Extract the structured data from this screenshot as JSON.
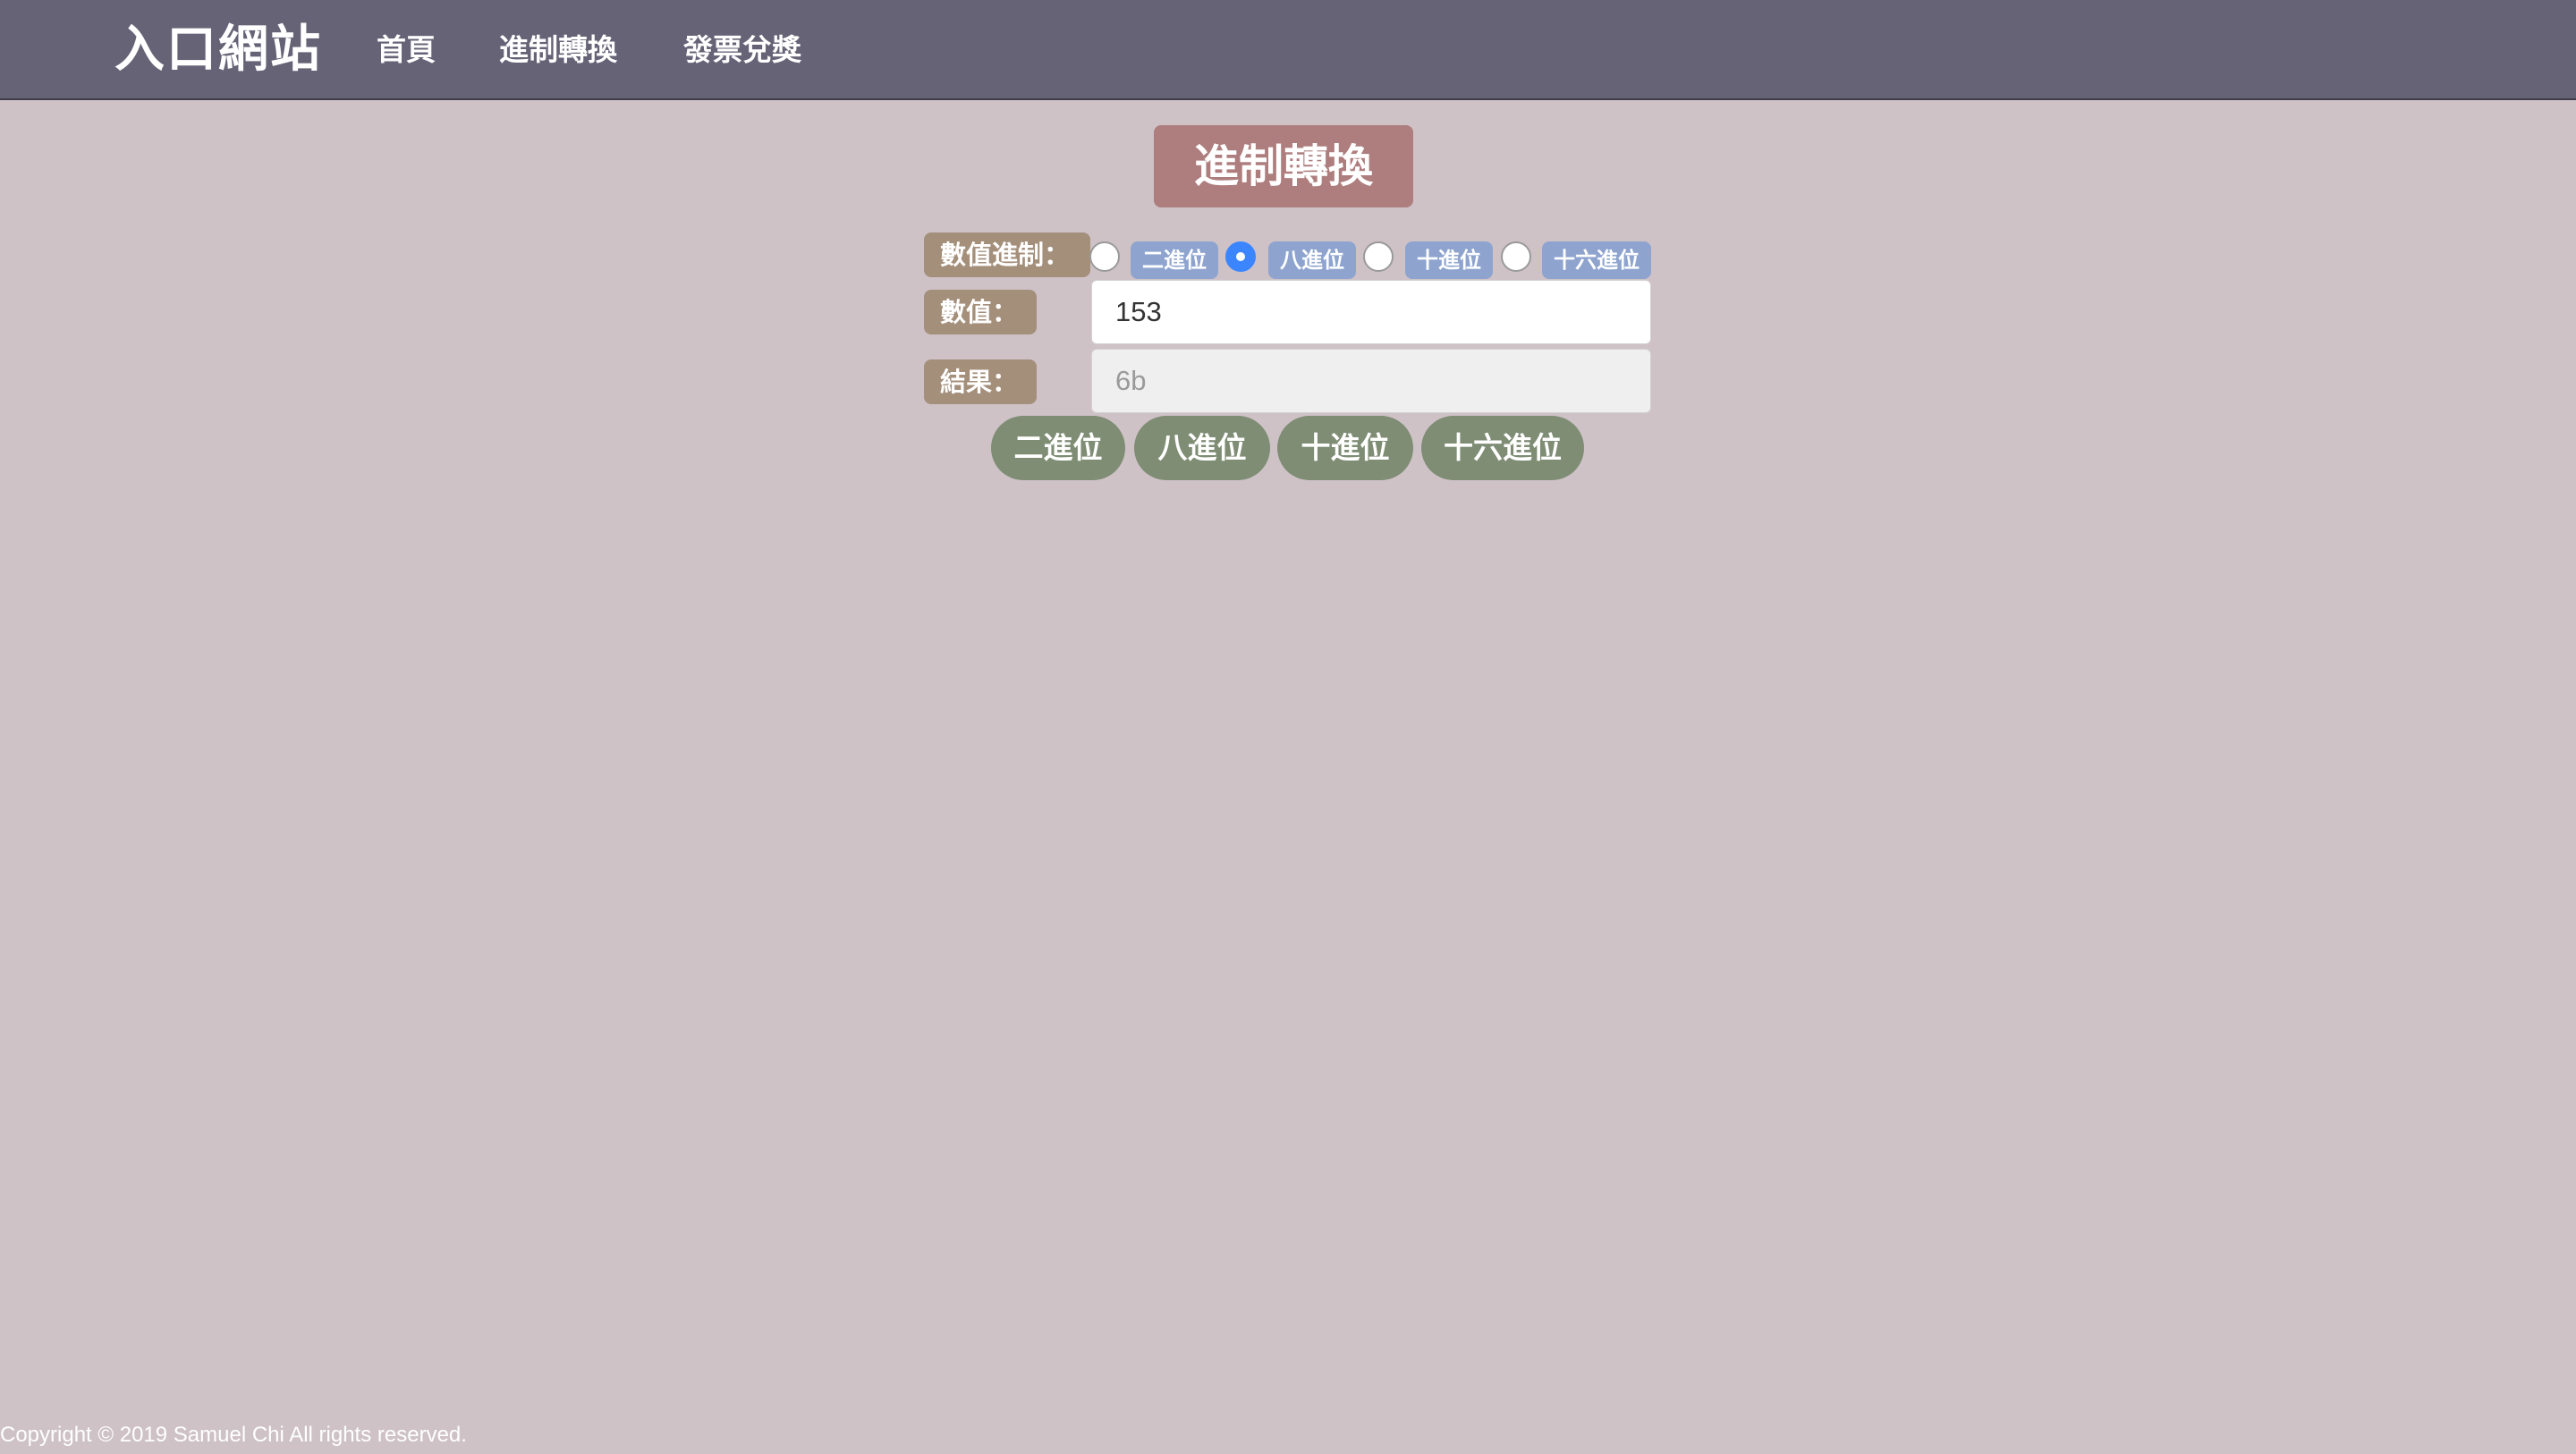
{
  "navbar": {
    "brand": "入口網站",
    "links": [
      "首頁",
      "進制轉換",
      "發票兌獎"
    ]
  },
  "main": {
    "title": "進制轉換",
    "base_label": "數值進制：",
    "radio_options": [
      "二進位",
      "八進位",
      "十進位",
      "十六進位"
    ],
    "selected_radio": "八進位",
    "value_label": "數值：",
    "value": "153",
    "result_label": "結果：",
    "result": "6b",
    "buttons": [
      "二進位",
      "八進位",
      "十進位",
      "十六進位"
    ]
  },
  "footer": {
    "copyright": "Copyright © 2019 Samuel Chi All rights reserved."
  },
  "colors": {
    "navbar": "#666377",
    "background": "#cec2c7",
    "title": "#ae7d7e",
    "label": "#a48f7b",
    "radio_label": "#8ea4cf",
    "button": "#7e8d74",
    "radio_checked": "#3b86ff"
  }
}
